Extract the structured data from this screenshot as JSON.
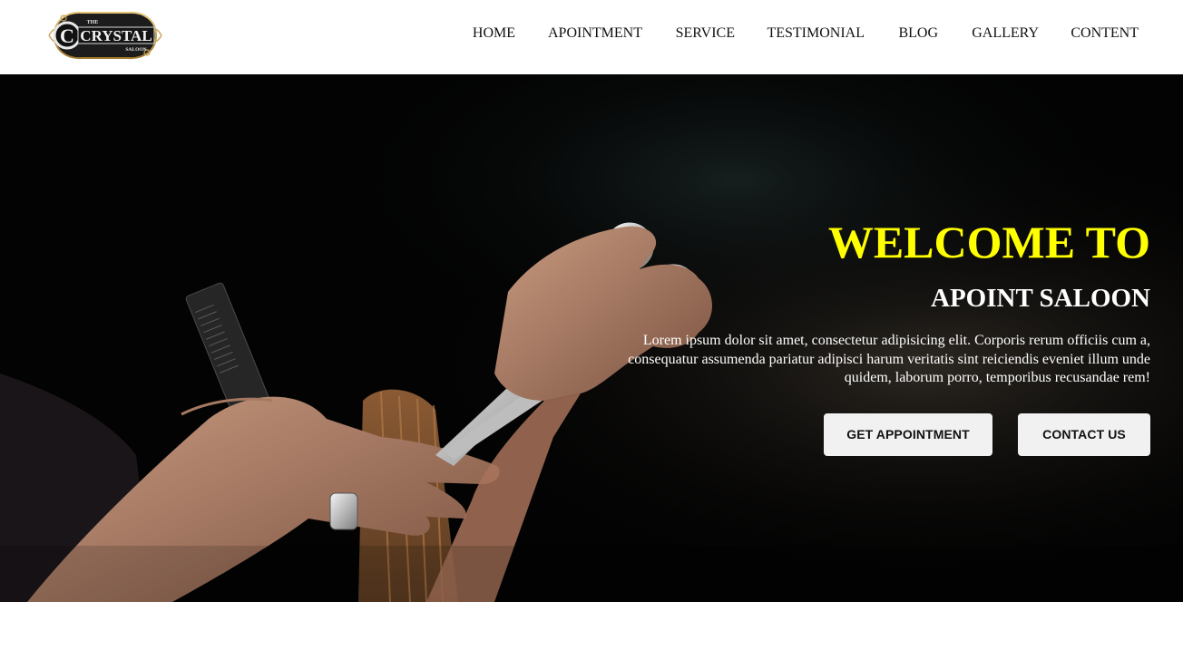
{
  "header": {
    "logo": {
      "top_text": "THE",
      "name": "CRYSTAL",
      "bottom_text": "SALOON"
    },
    "nav": [
      {
        "label": "HOME"
      },
      {
        "label": "APOINTMENT"
      },
      {
        "label": "SERVICE"
      },
      {
        "label": "TESTIMONIAL"
      },
      {
        "label": "BLOG"
      },
      {
        "label": "GALLERY"
      },
      {
        "label": "CONTENT"
      }
    ]
  },
  "hero": {
    "title": "WELCOME TO",
    "subtitle": "APOINT SALOON",
    "description": "Lorem ipsum dolor sit amet, consectetur adipisicing elit. Corporis rerum officiis cum a, consequatur assumenda pariatur adipisci harum veritatis sint reiciendis eveniet illum unde quidem, laborum porro, temporibus recusandae rem!",
    "buttons": {
      "appointment": "GET APPOINTMENT",
      "contact": "CONTACT US"
    }
  },
  "colors": {
    "title_accent": "#ffff00",
    "hero_background": "#050505",
    "button_background": "#f1f1f1",
    "nav_text": "#111111"
  }
}
